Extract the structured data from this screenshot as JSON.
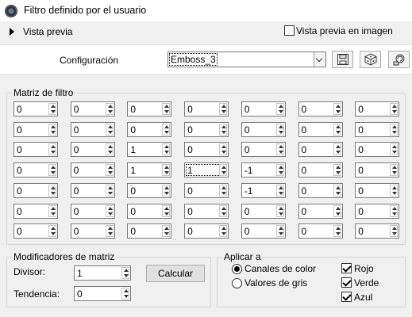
{
  "window": {
    "title": "Filtro definido por el usuario"
  },
  "preview": {
    "label": "Vista previa",
    "image_preview_label": "Vista previa en imagen",
    "image_preview_checked": false
  },
  "config": {
    "label": "Configuración",
    "selected": "Emboss_3"
  },
  "matrix": {
    "title": "Matriz de filtro",
    "rows": [
      [
        "0",
        "0",
        "0",
        "0",
        "0",
        "0",
        "0"
      ],
      [
        "0",
        "0",
        "0",
        "0",
        "0",
        "0",
        "0"
      ],
      [
        "0",
        "0",
        "1",
        "0",
        "0",
        "0",
        "0"
      ],
      [
        "0",
        "0",
        "1",
        "1",
        "-1",
        "0",
        "0"
      ],
      [
        "0",
        "0",
        "0",
        "0",
        "-1",
        "0",
        "0"
      ],
      [
        "0",
        "0",
        "0",
        "0",
        "0",
        "0",
        "0"
      ],
      [
        "0",
        "0",
        "0",
        "0",
        "0",
        "0",
        "0"
      ]
    ]
  },
  "modifiers": {
    "title": "Modificadores de matriz",
    "divisor_label": "Divisor:",
    "divisor": "1",
    "bias_label": "Tendencia:",
    "bias": "0",
    "calc_button": "Calcular"
  },
  "apply": {
    "title": "Aplicar a",
    "color_channels": "Canales de color",
    "gray_values": "Valores de gris",
    "selected": "color_channels",
    "red": "Rojo",
    "green": "Verde",
    "blue": "Azul",
    "red_checked": true,
    "green_checked": true,
    "blue_checked": true
  }
}
